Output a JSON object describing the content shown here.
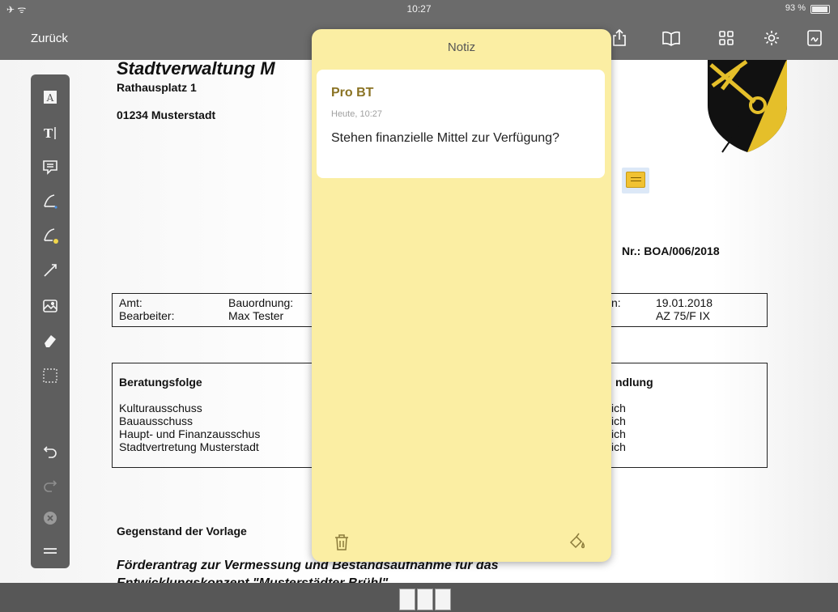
{
  "status": {
    "time": "10:27",
    "battery": "93 %"
  },
  "nav": {
    "back_label": "Zurück"
  },
  "document": {
    "title": "Stadtverwaltung M",
    "street": "Rathausplatz 1",
    "city": "01234 Musterstadt",
    "number": "Nr.: BOA/006/2018",
    "info": {
      "amt_label": "Amt:",
      "amt_value": "Bauordnung:",
      "bearbeiter_label": "Bearbeiter:",
      "bearbeiter_value": "Max Tester",
      "right_label": "n:",
      "date": "19.01.2018",
      "az": "AZ 75/F IX"
    },
    "beratung": {
      "header": "Beratungsfolge",
      "right_header": "ndlung",
      "rows": [
        "Kulturausschuss",
        "Bauausschuss",
        "Haupt- und Finanzausschus",
        "Stadtvertretung Musterstadt"
      ],
      "right_rows": [
        "ich",
        "ich",
        "ich",
        "ich"
      ]
    },
    "gegenstand": "Gegenstand der Vorlage",
    "foerder_line1": "Förderantrag zur Vermessung und Bestandsaufnahme für das",
    "foerder_line2": "Entwicklungskonzept \"Musterstädter Brühl\""
  },
  "note": {
    "title": "Notiz",
    "author": "Pro BT",
    "time": "Heute, 10:27",
    "text": "Stehen finanzielle Mittel zur Verfügung?"
  },
  "toolbar_icons": [
    "text-box-icon",
    "text-cursor-icon",
    "comment-icon",
    "pen-icon",
    "highlighter-icon",
    "line-icon",
    "image-icon",
    "eraser-icon",
    "selection-icon",
    "undo-icon",
    "redo-icon",
    "close-icon",
    "menu-icon"
  ],
  "colors": {
    "note_bg": "#fbeea3",
    "author": "#8a7324",
    "nav_bg": "#6b6b6b",
    "marker": "#f1c232"
  }
}
